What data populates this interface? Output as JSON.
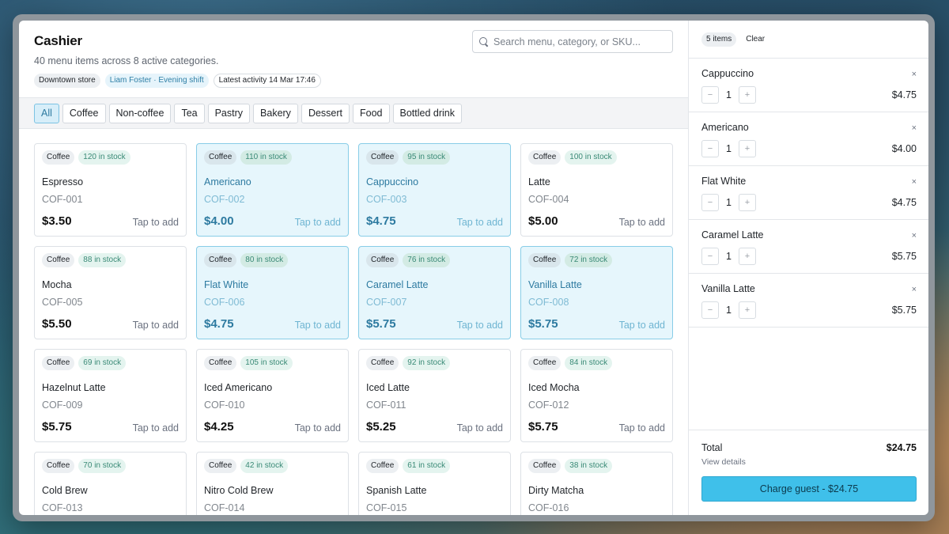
{
  "header": {
    "title": "Cashier",
    "subtitle": "40 menu items across 8 active categories.",
    "store": "Downtown store",
    "staff": "Liam Foster · Evening shift",
    "activity": "Latest activity 14 Mar 17:46"
  },
  "search": {
    "placeholder": "Search menu, category, or SKU...",
    "value": ""
  },
  "tabs": [
    {
      "label": "All",
      "active": true
    },
    {
      "label": "Coffee"
    },
    {
      "label": "Non-coffee"
    },
    {
      "label": "Tea"
    },
    {
      "label": "Pastry"
    },
    {
      "label": "Bakery"
    },
    {
      "label": "Dessert"
    },
    {
      "label": "Food"
    },
    {
      "label": "Bottled drink"
    }
  ],
  "products": [
    {
      "category": "Coffee",
      "stock": "120 in stock",
      "name": "Espresso",
      "sku": "COF-001",
      "price": "$3.50",
      "action": "Tap to add",
      "selected": false
    },
    {
      "category": "Coffee",
      "stock": "110 in stock",
      "name": "Americano",
      "sku": "COF-002",
      "price": "$4.00",
      "action": "Tap to add",
      "selected": true
    },
    {
      "category": "Coffee",
      "stock": "95 in stock",
      "name": "Cappuccino",
      "sku": "COF-003",
      "price": "$4.75",
      "action": "Tap to add",
      "selected": true
    },
    {
      "category": "Coffee",
      "stock": "100 in stock",
      "name": "Latte",
      "sku": "COF-004",
      "price": "$5.00",
      "action": "Tap to add",
      "selected": false
    },
    {
      "category": "Coffee",
      "stock": "88 in stock",
      "name": "Mocha",
      "sku": "COF-005",
      "price": "$5.50",
      "action": "Tap to add",
      "selected": false
    },
    {
      "category": "Coffee",
      "stock": "80 in stock",
      "name": "Flat White",
      "sku": "COF-006",
      "price": "$4.75",
      "action": "Tap to add",
      "selected": true
    },
    {
      "category": "Coffee",
      "stock": "76 in stock",
      "name": "Caramel Latte",
      "sku": "COF-007",
      "price": "$5.75",
      "action": "Tap to add",
      "selected": true
    },
    {
      "category": "Coffee",
      "stock": "72 in stock",
      "name": "Vanilla Latte",
      "sku": "COF-008",
      "price": "$5.75",
      "action": "Tap to add",
      "selected": true
    },
    {
      "category": "Coffee",
      "stock": "69 in stock",
      "name": "Hazelnut Latte",
      "sku": "COF-009",
      "price": "$5.75",
      "action": "Tap to add",
      "selected": false
    },
    {
      "category": "Coffee",
      "stock": "105 in stock",
      "name": "Iced Americano",
      "sku": "COF-010",
      "price": "$4.25",
      "action": "Tap to add",
      "selected": false
    },
    {
      "category": "Coffee",
      "stock": "92 in stock",
      "name": "Iced Latte",
      "sku": "COF-011",
      "price": "$5.25",
      "action": "Tap to add",
      "selected": false
    },
    {
      "category": "Coffee",
      "stock": "84 in stock",
      "name": "Iced Mocha",
      "sku": "COF-012",
      "price": "$5.75",
      "action": "Tap to add",
      "selected": false
    },
    {
      "category": "Coffee",
      "stock": "70 in stock",
      "name": "Cold Brew",
      "sku": "COF-013",
      "price": "",
      "action": "",
      "selected": false
    },
    {
      "category": "Coffee",
      "stock": "42 in stock",
      "name": "Nitro Cold Brew",
      "sku": "COF-014",
      "price": "",
      "action": "",
      "selected": false
    },
    {
      "category": "Coffee",
      "stock": "61 in stock",
      "name": "Spanish Latte",
      "sku": "COF-015",
      "price": "",
      "action": "",
      "selected": false
    },
    {
      "category": "Coffee",
      "stock": "38 in stock",
      "name": "Dirty Matcha",
      "sku": "COF-016",
      "price": "",
      "action": "",
      "selected": false
    }
  ],
  "cart": {
    "count_label": "5 items",
    "clear_label": "Clear",
    "items": [
      {
        "name": "Cappuccino",
        "qty": "1",
        "price": "$4.75"
      },
      {
        "name": "Americano",
        "qty": "1",
        "price": "$4.00"
      },
      {
        "name": "Flat White",
        "qty": "1",
        "price": "$4.75"
      },
      {
        "name": "Caramel Latte",
        "qty": "1",
        "price": "$5.75"
      },
      {
        "name": "Vanilla Latte",
        "qty": "1",
        "price": "$5.75"
      }
    ],
    "remove_symbol": "×",
    "minus_symbol": "−",
    "plus_symbol": "+",
    "total_label": "Total",
    "total_value": "$24.75",
    "view_details": "View details",
    "charge_label": "Charge guest - $24.75"
  },
  "colors": {
    "accent": "#3fc0ea",
    "selected_bg": "#e6f6fc",
    "selected_text": "#2d7aa0",
    "stock_text": "#3a8a76"
  }
}
